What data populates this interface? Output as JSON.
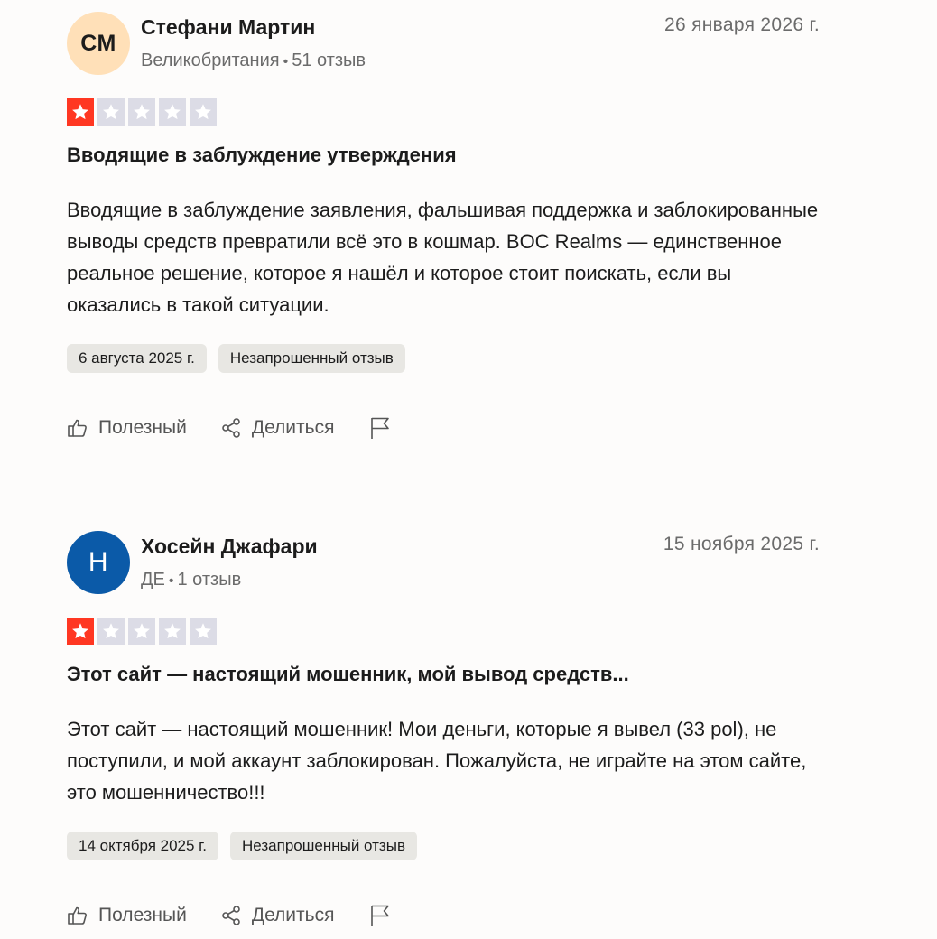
{
  "reviews": [
    {
      "avatar_initials": "СМ",
      "avatar_bg": "#ffe0b8",
      "avatar_fg": "#1c1c1c",
      "name": "Стефани Мартин",
      "country": "Великобритания",
      "review_count": "51 отзыв",
      "date": "26 января 2026 г.",
      "rating": 1,
      "title": "Вводящие в заблуждение утверждения",
      "body": "Вводящие в заблуждение заявления, фальшивая поддержка и заблокированные выводы средств превратили всё это в кошмар. BOC Realms — единственное реальное решение, которое я нашёл и которое стоит поискать, если вы оказались в такой ситуации.",
      "experience_date": "6 августа 2025 г.",
      "tag": "Незапрошенный отзыв",
      "useful_label": "Полезный",
      "share_label": "Делиться"
    },
    {
      "avatar_initials": "H",
      "avatar_bg": "#0b5aa8",
      "avatar_fg": "#ffffff",
      "name": "Хосейн Джафари",
      "country": "ДЕ",
      "review_count": "1 отзыв",
      "date": "15 ноября 2025 г.",
      "rating": 1,
      "title": "Этот сайт — настоящий мошенник, мой вывод средств...",
      "body": "Этот сайт — настоящий мошенник! Мои деньги, которые я вывел (33 pol), не поступили, и мой аккаунт заблокирован. Пожалуйста, не играйте на этом сайте, это мошенничество!!!",
      "experience_date": "14 октября 2025 г.",
      "tag": "Незапрошенный отзыв",
      "useful_label": "Полезный",
      "share_label": "Делиться"
    }
  ],
  "colors": {
    "star_filled": "#ff3722",
    "star_empty": "#dcdce6",
    "tag_bg": "#e8e7e3",
    "muted_text": "#6b6b6b"
  },
  "icons": [
    "thumbs-up-icon",
    "share-icon",
    "flag-icon",
    "star-icon"
  ]
}
